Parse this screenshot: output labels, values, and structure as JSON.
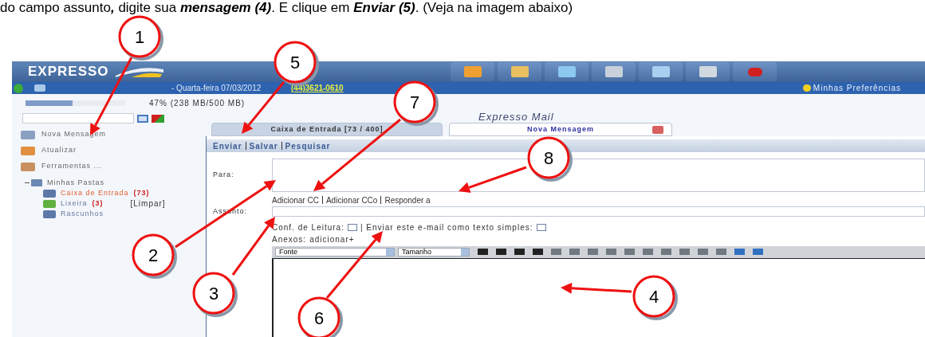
{
  "caption": "do campo assunto**,** digite sua **mensagem (4)**. E clique em **Enviar (5)**. (Veja na imagem abaixo)",
  "app": {
    "logo": "EXPRESSO",
    "date": "- Quarta-feira 07/03/2012",
    "phone": "(44)3621-0610",
    "preferences": "Minhas Preferências",
    "quota": {
      "level": 0.47,
      "reading": "47% (238 MB/500 MB)"
    },
    "menu": [
      {
        "label": "Nova Mensagem"
      },
      {
        "label": "Atualizar"
      },
      {
        "label": "Ferramentas ..."
      }
    ],
    "folders": {
      "label": "Minhas Pastas",
      "expanded": true,
      "children": [
        {
          "label": "Caixa de Entrada",
          "count": "(73)",
          "selected": true
        },
        {
          "label": "Lixeira",
          "count": "(3)",
          "action": "[Limpar]",
          "selected": false
        },
        {
          "label": "Rascunhos",
          "selected": false
        }
      ]
    },
    "title": "Expresso Mail",
    "tabs": [
      {
        "label": "Caixa de Entrada [73 / 400]",
        "selected": false
      },
      {
        "label": "Nova Mensagem",
        "selected": true
      }
    ],
    "actions": [
      "Enviar",
      "Salvar",
      "Pesquisar"
    ],
    "to_label": "Para:",
    "links": [
      "Adicionar CC",
      "Adicionar CCo",
      "Responder a"
    ],
    "subject_label": "Assunto:",
    "options": [
      {
        "label": "Conf. de Leitura:",
        "checked": false
      },
      {
        "label": "| Enviar este e-mail como texto simples:",
        "checked": false
      }
    ],
    "attachments": {
      "label": "Anexos:",
      "link": "adicionar+"
    },
    "font_select": "Fonte",
    "size_select": "Tamanho"
  },
  "annotations": [
    "1",
    "5",
    "7",
    "8",
    "2",
    "3",
    "6",
    "4"
  ]
}
